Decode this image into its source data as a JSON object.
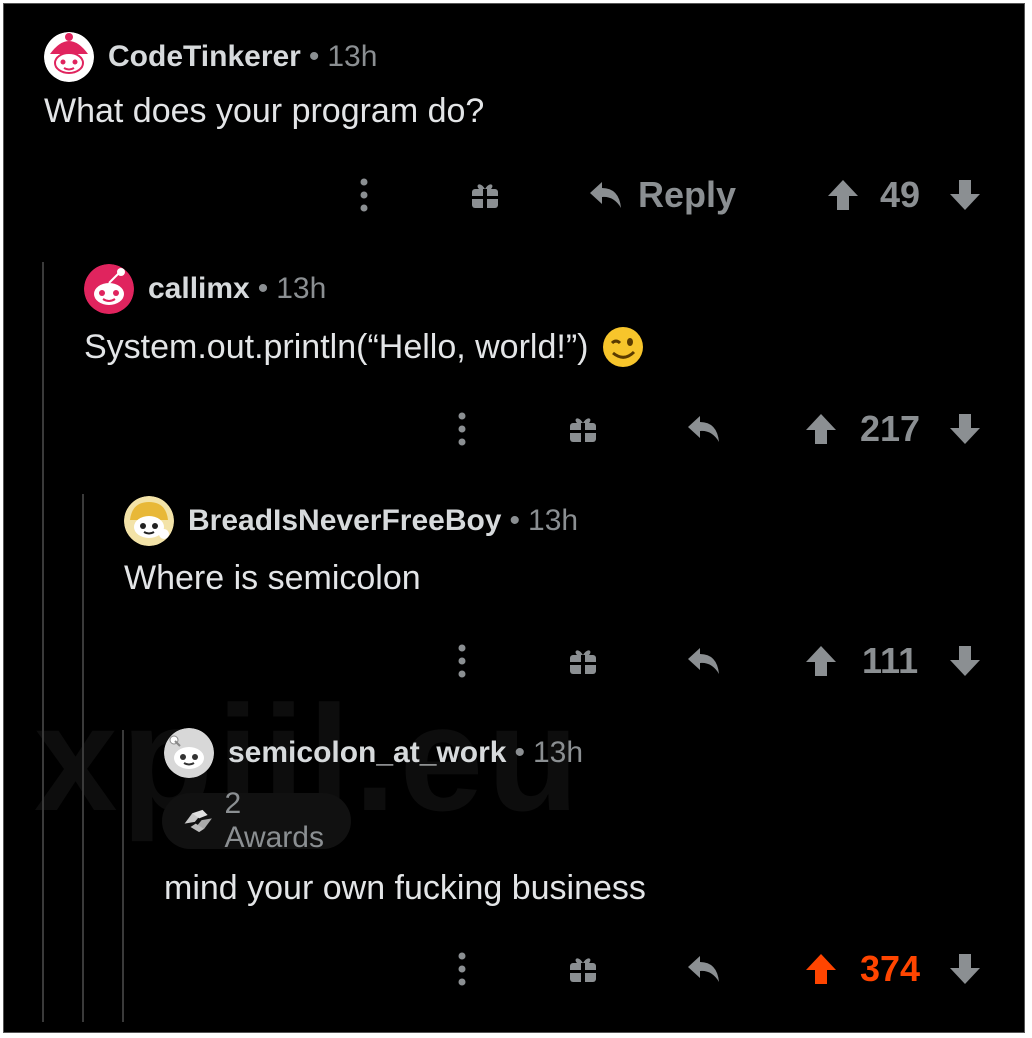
{
  "comments": [
    {
      "username": "CodeTinkerer",
      "time": "13h",
      "separator": "•",
      "body": "What does your program do?",
      "reply_label": "Reply",
      "score": "49",
      "upvoted": false
    },
    {
      "username": "callimx",
      "time": "13h",
      "separator": "•",
      "body": "System.out.println(“Hello, world!”)",
      "emoji": "winking-face",
      "score": "217",
      "upvoted": false
    },
    {
      "username": "BreadIsNeverFreeBoy",
      "time": "13h",
      "separator": "•",
      "body": "Where is semicolon",
      "score": "111",
      "upvoted": false
    },
    {
      "username": "semicolon_at_work",
      "time": "13h",
      "separator": "•",
      "awards": "2 Awards",
      "body": "mind your own fucking business",
      "score": "374",
      "upvoted": true
    }
  ],
  "watermark": "xpiil.eu",
  "icons": {
    "more": "more-vertical-icon",
    "award": "gift-icon",
    "reply": "reply-arrow-icon",
    "upvote": "upvote-arrow-icon",
    "downvote": "downvote-arrow-icon",
    "award_badge": "helping-hand-icon"
  },
  "colors": {
    "background": "#000000",
    "muted": "#8b8f92",
    "upvote_active": "#ff4500",
    "avatar_red": "#e0245e"
  }
}
